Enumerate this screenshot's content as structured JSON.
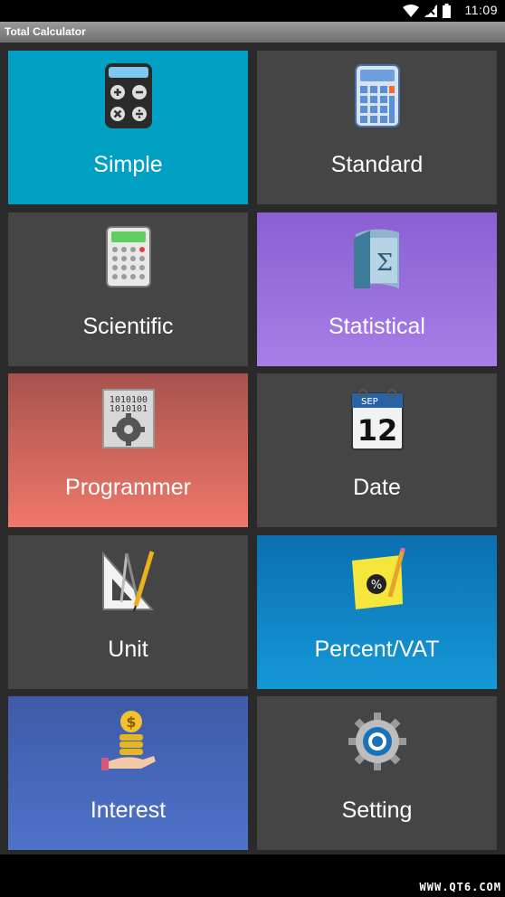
{
  "status_bar": {
    "time": "11:09",
    "icons": [
      "wifi-icon",
      "signal-icon",
      "battery-icon"
    ]
  },
  "app": {
    "title": "Total Calculator"
  },
  "tiles": [
    {
      "label": "Simple",
      "icon": "calculator-operators-icon",
      "color": "#00a0c3"
    },
    {
      "label": "Standard",
      "icon": "keypad-calculator-icon",
      "color": "#454545"
    },
    {
      "label": "Scientific",
      "icon": "scientific-calculator-icon",
      "color": "#454545"
    },
    {
      "label": "Statistical",
      "icon": "sigma-document-icon",
      "color": "#9a70dc"
    },
    {
      "label": "Programmer",
      "icon": "binary-gear-icon",
      "color": "#d9655c"
    },
    {
      "label": "Date",
      "icon": "calendar-icon",
      "color": "#454545",
      "icon_month": "SEP",
      "icon_day": "12"
    },
    {
      "label": "Unit",
      "icon": "ruler-compass-icon",
      "color": "#454545"
    },
    {
      "label": "Percent/VAT",
      "icon": "percent-note-icon",
      "color": "#1285c6",
      "icon_symbol": "%"
    },
    {
      "label": "Interest",
      "icon": "coins-hand-icon",
      "color": "#4667b9",
      "icon_symbol": "$"
    },
    {
      "label": "Setting",
      "icon": "gear-icon",
      "color": "#454545"
    }
  ],
  "watermark": "WWW.QT6.COM"
}
